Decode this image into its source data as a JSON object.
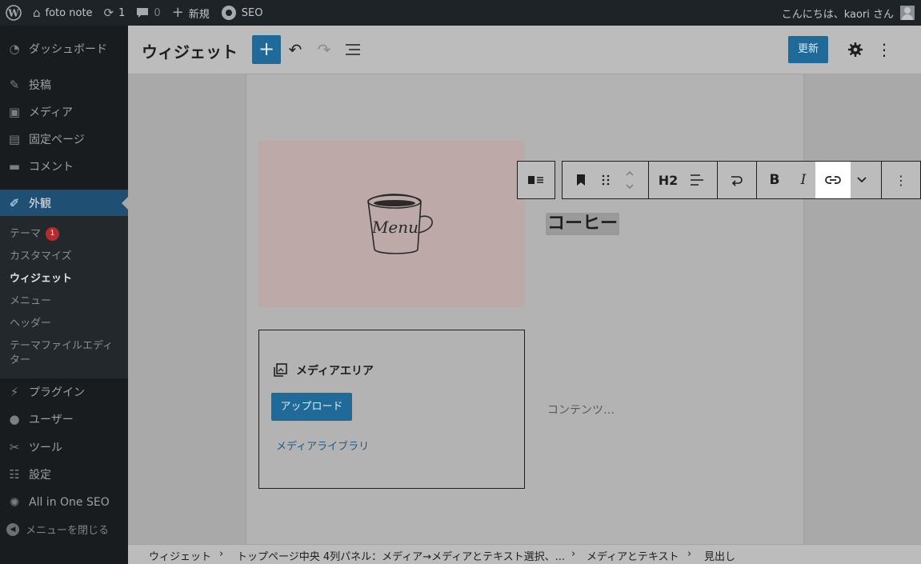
{
  "adminbar": {
    "site_name": "foto note",
    "updates_count": "1",
    "comments_count": "0",
    "new_label": "新規",
    "seo_label": "SEO",
    "greeting": "こんにちは、kaori さん"
  },
  "sidebar": {
    "items": [
      {
        "label": "ダッシュボード",
        "icon": "dashboard-icon"
      },
      {
        "label": "投稿",
        "icon": "pin-icon"
      },
      {
        "label": "メディア",
        "icon": "media-icon"
      },
      {
        "label": "固定ページ",
        "icon": "page-icon"
      },
      {
        "label": "コメント",
        "icon": "comment-icon"
      },
      {
        "label": "外観",
        "icon": "brush-icon"
      },
      {
        "label": "プラグイン",
        "icon": "plugin-icon"
      },
      {
        "label": "ユーザー",
        "icon": "user-icon"
      },
      {
        "label": "ツール",
        "icon": "wrench-icon"
      },
      {
        "label": "設定",
        "icon": "settings-icon"
      },
      {
        "label": "All in One SEO",
        "icon": "seo-icon"
      }
    ],
    "submenu": [
      {
        "label": "テーマ",
        "badge": "1"
      },
      {
        "label": "カスタマイズ"
      },
      {
        "label": "ウィジェット"
      },
      {
        "label": "メニュー"
      },
      {
        "label": "ヘッダー"
      },
      {
        "label": "テーマファイルエディター"
      }
    ],
    "collapse_label": "メニューを閉じる"
  },
  "header": {
    "title": "ウィジェット",
    "update_label": "更新"
  },
  "toolbar": {
    "heading_level": "H2",
    "bold": "B",
    "italic": "I"
  },
  "content": {
    "heading": "コーヒー",
    "image_text": "Menu",
    "placeholder": "コンテンツ…",
    "media_area_title": "メディアエリア",
    "upload_label": "アップロード",
    "library_label": "メディアライブラリ"
  },
  "breadcrumb": [
    "ウィジェット",
    "トップページ中央 4列パネル：メディア→メディアとテキスト選択、...",
    "メディアとテキスト",
    "見出し"
  ],
  "colors": {
    "admin_bar": "#1d2327",
    "accent": "#1f6a98",
    "active_menu": "#1f4f73",
    "badge": "#b32d2e"
  }
}
